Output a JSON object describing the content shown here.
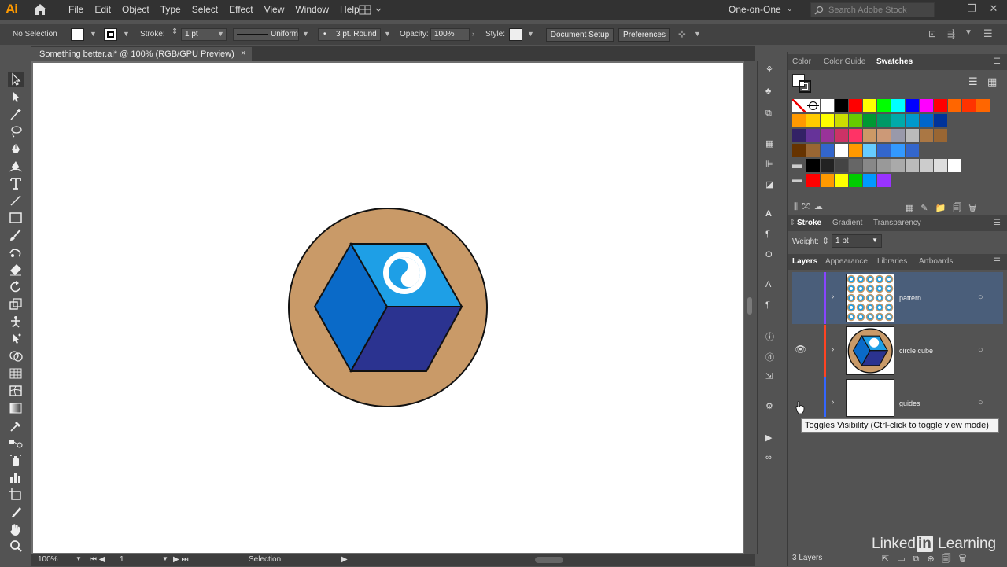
{
  "app": {
    "logo": "Ai",
    "menus": [
      "File",
      "Edit",
      "Object",
      "Type",
      "Select",
      "Effect",
      "View",
      "Window",
      "Help"
    ],
    "workspace": "One-on-One",
    "search_placeholder": "Search Adobe Stock"
  },
  "control_bar": {
    "selection_label": "No Selection",
    "stroke_label": "Stroke:",
    "stroke_value": "1 pt",
    "profile": "Uniform",
    "brush": "3 pt. Round",
    "opacity_label": "Opacity:",
    "opacity_value": "100%",
    "style_label": "Style:",
    "document_setup": "Document Setup",
    "preferences": "Preferences"
  },
  "document": {
    "tab_title": "Something better.ai* @ 100% (RGB/GPU Preview)",
    "close": "×"
  },
  "status": {
    "zoom": "100%",
    "artboard": "1",
    "tool": "Selection"
  },
  "color_panel": {
    "tabs": [
      "Color",
      "Color Guide",
      "Swatches"
    ],
    "active_tab": "Swatches"
  },
  "swatch_colors": {
    "row1": [
      "#ffffff",
      "#000000",
      "#ff0000",
      "#ffff00",
      "#00ff00",
      "#00ffff",
      "#0000ff",
      "#ff00ff",
      "#ff0000",
      "#ff6600",
      "#ff3300",
      "#ff6600"
    ],
    "row2": [
      "#ff9900",
      "#ffcc00",
      "#ffff00",
      "#ccdd00",
      "#66cc00",
      "#009933",
      "#009966",
      "#00aaaa",
      "#0099cc",
      "#0066cc",
      "#003399"
    ],
    "row3": [
      "#332266",
      "#663399",
      "#993399",
      "#cc3366",
      "#ff3366",
      "#cc9966",
      "#cc9977",
      "#9999aa",
      "#bbbbbb",
      "#aa7744",
      "#996633"
    ],
    "row4": [
      "#663300",
      "#996633",
      "#3366cc",
      "#ffffff",
      "#ff9900",
      "#66ccff",
      "#3366cc",
      "#3399ff",
      "#3366cc"
    ],
    "row5": [
      "#000000",
      "#222222",
      "#444444",
      "#666666",
      "#888888",
      "#999999",
      "#aaaaaa",
      "#bbbbbb",
      "#cccccc",
      "#dddddd",
      "#ffffff"
    ],
    "row6": [
      "#ff0000",
      "#ff9900",
      "#ffff00",
      "#00cc00",
      "#0099ff",
      "#9933ff"
    ]
  },
  "stroke_panel": {
    "tabs": [
      "Stroke",
      "Gradient",
      "Transparency"
    ],
    "active_tab": "Stroke",
    "weight_label": "Weight:",
    "weight_value": "1 pt"
  },
  "layers_panel": {
    "tabs": [
      "Layers",
      "Appearance",
      "Libraries",
      "Artboards"
    ],
    "active_tab": "Layers",
    "layers": [
      {
        "name": "pattern",
        "color": "#8844ff",
        "visible": false,
        "selected": true
      },
      {
        "name": "circle cube",
        "color": "#ff4422",
        "visible": true,
        "selected": false
      },
      {
        "name": "guides",
        "color": "#3366ff",
        "visible": false,
        "selected": false
      }
    ],
    "count_label": "3 Layers"
  },
  "tooltip": "Toggles Visibility (Ctrl-click to toggle view mode)",
  "watermark": "Linked in Learning"
}
